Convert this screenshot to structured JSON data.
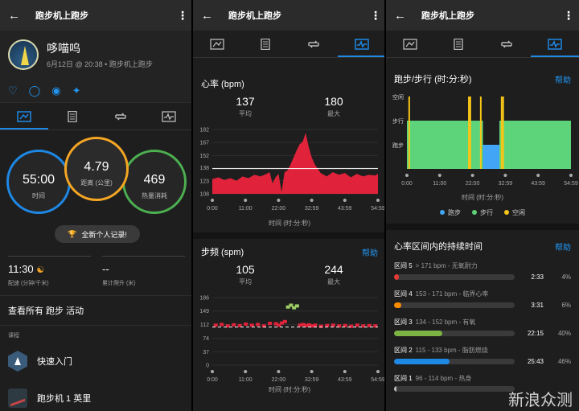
{
  "header": {
    "title": "跑步机上跑步"
  },
  "profile": {
    "name": "哆喵呜",
    "subtitle": "6月12日 @ 20:38 • 跑步机上跑步"
  },
  "circles": [
    {
      "value": "55:00",
      "label": "时间",
      "color": "#1e88e5"
    },
    {
      "value": "4.79",
      "label": "距离 (公里)",
      "color": "#f5a623"
    },
    {
      "value": "469",
      "label": "热量消耗",
      "color": "#4caf50"
    }
  ],
  "record": {
    "label": "全新个人记录!"
  },
  "stats": [
    {
      "value": "11:30",
      "label": "配速 (分钟/千米)"
    },
    {
      "value": "--",
      "label": "累计爬升 (米)"
    }
  ],
  "view_all": "查看所有 跑步 活动",
  "courses_header": "课程",
  "courses": [
    {
      "label": "快速入门"
    },
    {
      "label": "跑步机 1 英里"
    }
  ],
  "hr": {
    "title": "心率 (bpm)",
    "avg": "137",
    "avg_label": "平均",
    "max": "180",
    "max_label": "最大",
    "xlabel": "时间 (时:分:秒)"
  },
  "cadence": {
    "title": "步频 (spm)",
    "help": "帮助",
    "avg": "105",
    "avg_label": "平均",
    "max": "244",
    "max_label": "最大",
    "xlabel": "时间 (时:分:秒)"
  },
  "runwalk": {
    "title": "跑步/步行 (时:分:秒)",
    "help": "帮助",
    "xlabel": "时间 (时:分:秒)"
  },
  "zones_title": "心率区间内的持续时间",
  "zones_help": "帮助",
  "zones": [
    {
      "name": "区间 5",
      "range": "> 171 bpm - 无氧耐力",
      "time": "2:33",
      "pct": "4%",
      "fill": 0.04,
      "color": "#e53935"
    },
    {
      "name": "区间 4",
      "range": "153 - 171 bpm - 临界心率",
      "time": "3:31",
      "pct": "6%",
      "fill": 0.06,
      "color": "#fb8c00"
    },
    {
      "name": "区间 3",
      "range": "134 - 152 bpm - 有氧",
      "time": "22:15",
      "pct": "40%",
      "fill": 0.4,
      "color": "#7cb342"
    },
    {
      "name": "区间 2",
      "range": "115 - 133 bpm - 脂肪燃烧",
      "time": "25:43",
      "pct": "46%",
      "fill": 0.46,
      "color": "#1e88e5"
    },
    {
      "name": "区间 1",
      "range": "96 - 114 bpm - 热身",
      "time": "",
      "pct": "",
      "fill": 0.02,
      "color": "#bbbbbb"
    }
  ],
  "watermark": "新浪众测",
  "chart_data": [
    {
      "type": "area",
      "title": "心率 (bpm)",
      "xlabel": "时间 (时:分:秒)",
      "x_ticks": [
        "0:00",
        "11:00",
        "22:00",
        "32:59",
        "43:59",
        "54:59"
      ],
      "y_ticks": [
        108,
        123,
        138,
        152,
        167,
        182
      ],
      "ylim": [
        108,
        182
      ],
      "avg_line": 137,
      "color": "#e0233a",
      "x": [
        0,
        2,
        4,
        6,
        8,
        10,
        12,
        14,
        16,
        18,
        19,
        20,
        21,
        22,
        23,
        24,
        25,
        26,
        27,
        28,
        29,
        30,
        31,
        32,
        33,
        34,
        36,
        38,
        40,
        42,
        44,
        46,
        48,
        50,
        52,
        54,
        55
      ],
      "values": [
        125,
        127,
        124,
        126,
        123,
        128,
        126,
        130,
        128,
        131,
        133,
        120,
        127,
        131,
        110,
        133,
        135,
        142,
        150,
        158,
        165,
        168,
        178,
        162,
        150,
        142,
        132,
        128,
        133,
        130,
        132,
        127,
        131,
        128,
        130,
        129,
        131
      ]
    },
    {
      "type": "scatter",
      "title": "步频 (spm)",
      "xlabel": "时间 (时:分:秒)",
      "x_ticks": [
        "0:00",
        "11:00",
        "22:00",
        "32:59",
        "43:59",
        "54:59"
      ],
      "y_ticks": [
        0,
        37,
        74,
        112,
        149,
        186
      ],
      "ylim": [
        0,
        186
      ],
      "avg_line": 105,
      "x": [
        1,
        3,
        5,
        7,
        9,
        11,
        13,
        15,
        17,
        19,
        21,
        22,
        23,
        24,
        25,
        26,
        27,
        28,
        29,
        30,
        31,
        32,
        33,
        34,
        36,
        38,
        40,
        42,
        44,
        46,
        48,
        50,
        52,
        54
      ],
      "values": [
        110,
        112,
        108,
        111,
        109,
        113,
        110,
        112,
        108,
        115,
        114,
        110,
        116,
        120,
        160,
        165,
        158,
        163,
        110,
        112,
        109,
        111,
        108,
        110,
        107,
        109,
        110,
        108,
        109,
        107,
        110,
        108,
        109,
        108
      ]
    },
    {
      "type": "area",
      "title": "跑步/步行 (时:分:秒)",
      "xlabel": "时间 (时:分:秒)",
      "x_ticks": [
        "0:00",
        "11:00",
        "22:00",
        "32:59",
        "43:59",
        "54:59"
      ],
      "y_categories": [
        "空闲",
        "步行",
        "跑步"
      ],
      "segments": [
        {
          "start": 0,
          "end": 25.5,
          "type": "步行"
        },
        {
          "start": 25.5,
          "end": 31,
          "type": "跑步"
        },
        {
          "start": 31,
          "end": 55,
          "type": "步行"
        }
      ],
      "idle_marks": [
        0.5,
        20.5,
        21,
        24.5,
        31.5,
        32
      ],
      "legend": [
        "跑步",
        "步行",
        "空闲"
      ],
      "colors": [
        "#42a5f5",
        "#5ed47a",
        "#f5c518"
      ]
    }
  ]
}
